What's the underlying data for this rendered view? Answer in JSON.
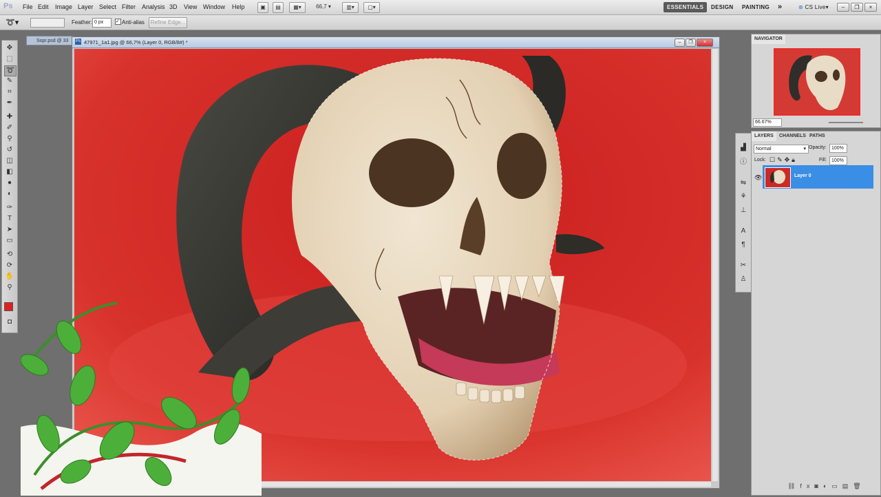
{
  "app": {
    "logo": "Ps"
  },
  "menu": [
    "File",
    "Edit",
    "Image",
    "Layer",
    "Select",
    "Filter",
    "Analysis",
    "3D",
    "View",
    "Window",
    "Help"
  ],
  "zoom_menu": "66,7",
  "workspaces": {
    "essentials": "ESSENTIALS",
    "design": "DESIGN",
    "painting": "PAINTING",
    "more": "»",
    "cslive": "CS Live"
  },
  "options": {
    "feather_label": "Feather:",
    "feather_value": "0 px",
    "antialias_label": "Anti-alias",
    "refine_edge": "Refine Edge..."
  },
  "documents": {
    "background_tab": "Sopr.psd @ 33",
    "active_title": "47971_1a1.jpg @ 66,7% (Layer 0, RGB/8#) *"
  },
  "navigator": {
    "tab": "NAVIGATOR",
    "zoom": "66.67%"
  },
  "layers_panel": {
    "tabs": [
      "LAYERS",
      "CHANNELS",
      "PATHS"
    ],
    "blend_mode": "Normal",
    "opacity_label": "Opacity:",
    "opacity_value": "100%",
    "lock_label": "Lock:",
    "fill_label": "Fill:",
    "fill_value": "100%",
    "layers": [
      {
        "name": "Layer 0",
        "visible": true,
        "selected": true
      }
    ]
  },
  "colors": {
    "accent_selection": "#3a8ee6",
    "foreground": "#e02020",
    "background": "#ffffff",
    "canvas_red": "#d9322e"
  },
  "icons": [
    "move-icon",
    "marquee-icon",
    "lasso-icon",
    "quick-select-icon",
    "crop-icon",
    "eyedropper-icon",
    "healing-icon",
    "brush-icon",
    "stamp-icon",
    "history-brush-icon",
    "eraser-icon",
    "gradient-icon",
    "blur-icon",
    "dodge-icon",
    "pen-icon",
    "type-icon",
    "path-select-icon",
    "shape-icon",
    "3d-rotate-icon",
    "3d-orbit-icon",
    "hand-icon",
    "zoom-icon",
    "eye-icon",
    "link-icon",
    "fx-icon",
    "mask-icon",
    "adjustment-icon",
    "folder-icon",
    "new-layer-icon",
    "trash-icon"
  ]
}
